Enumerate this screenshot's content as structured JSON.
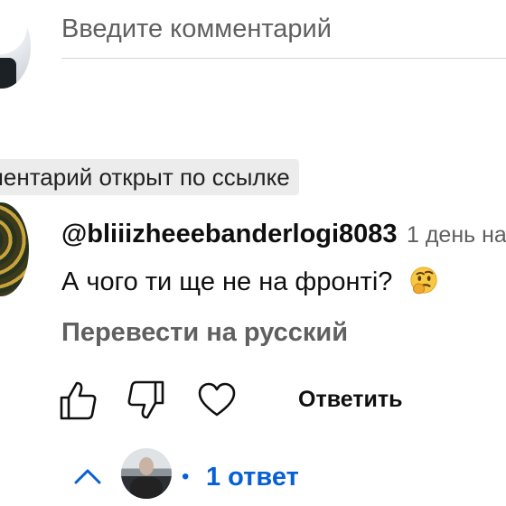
{
  "comment_input": {
    "placeholder": "Введите комментарий"
  },
  "link_chip": {
    "label": "ментарий открыт по ссылке"
  },
  "comment": {
    "author": "@bliiizheeebanderlogi8083",
    "time": "1 день на",
    "text": "А чого ти ще не на фронті?",
    "emoji": "thinking-face-icon",
    "translate_label": "Перевести на русский",
    "reply_label": "Ответить",
    "icons": [
      "thumb-up-icon",
      "thumb-down-icon",
      "heart-icon"
    ]
  },
  "replies": {
    "toggle_icon": "chevron-up-icon",
    "dot": "•",
    "count_label": "1 ответ",
    "accent": "#065fd4"
  }
}
